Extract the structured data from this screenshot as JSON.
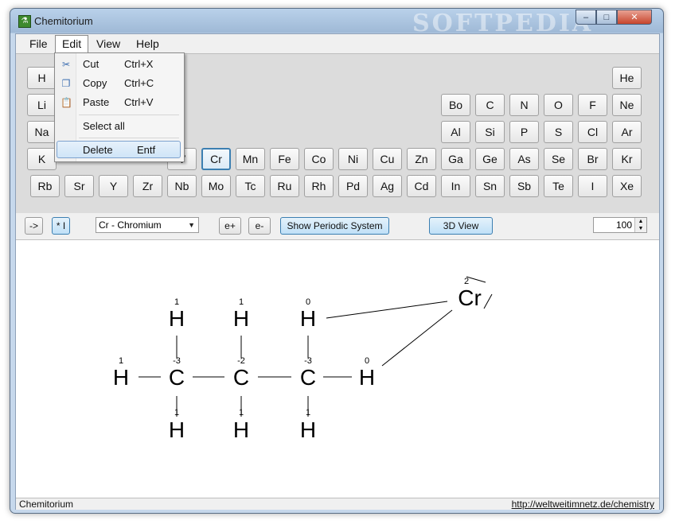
{
  "window": {
    "title": "Chemitorium",
    "watermark": "SOFTPEDIA",
    "min_glyph": "–",
    "max_glyph": "□",
    "close_glyph": "✕"
  },
  "menubar": {
    "file": "File",
    "edit": "Edit",
    "view": "View",
    "help": "Help"
  },
  "edit_menu": {
    "cut": {
      "label": "Cut",
      "shortcut": "Ctrl+X",
      "icon": "scissors-icon"
    },
    "copy": {
      "label": "Copy",
      "shortcut": "Ctrl+C",
      "icon": "copy-icon"
    },
    "paste": {
      "label": "Paste",
      "shortcut": "Ctrl+V",
      "icon": "paste-icon"
    },
    "select_all": {
      "label": "Select all"
    },
    "delete": {
      "label": "Delete",
      "shortcut": "Entf"
    }
  },
  "elements": {
    "row1": [
      "H",
      "He"
    ],
    "row2": [
      "Li",
      "Bo",
      "C",
      "N",
      "O",
      "F",
      "Ne"
    ],
    "row3": [
      "Na",
      "Al",
      "Si",
      "P",
      "S",
      "Cl",
      "Ar"
    ],
    "row4": [
      "K",
      "V",
      "Cr",
      "Mn",
      "Fe",
      "Co",
      "Ni",
      "Cu",
      "Zn",
      "Ga",
      "Ge",
      "As",
      "Se",
      "Br",
      "Kr"
    ],
    "row5": [
      "Rb",
      "Sr",
      "Y",
      "Zr",
      "Nb",
      "Mo",
      "Tc",
      "Ru",
      "Rh",
      "Pd",
      "Ag",
      "Cd",
      "In",
      "Sn",
      "Sb",
      "Te",
      "I",
      "Xe"
    ],
    "selected": "Cr"
  },
  "toolbar": {
    "arrow_btn": "->",
    "star_btn": "* I",
    "element_select": "Cr - Chromium",
    "e_plus": "e+",
    "e_minus": "e-",
    "show_periodic": "Show Periodic System",
    "view_3d": "3D View",
    "zoom": "100"
  },
  "molecule": {
    "atoms": {
      "h_top1": "H",
      "h_top2": "H",
      "h_top3": "H",
      "h_left": "H",
      "c1": "C",
      "c2": "C",
      "c3": "C",
      "h_right": "H",
      "h_bot1": "H",
      "h_bot2": "H",
      "h_bot3": "H",
      "cr": "Cr"
    },
    "charges": {
      "h_top1": "1",
      "h_top2": "1",
      "h_top3": "0",
      "h_left": "1",
      "c1": "-3",
      "c2": "-2",
      "c3": "-3",
      "h_right": "0",
      "h_bot1": "1",
      "h_bot2": "1",
      "h_bot3": "1",
      "cr": "2"
    }
  },
  "status": {
    "left": "Chemitorium",
    "link": "http://weltweitimnetz.de/chemistry"
  }
}
